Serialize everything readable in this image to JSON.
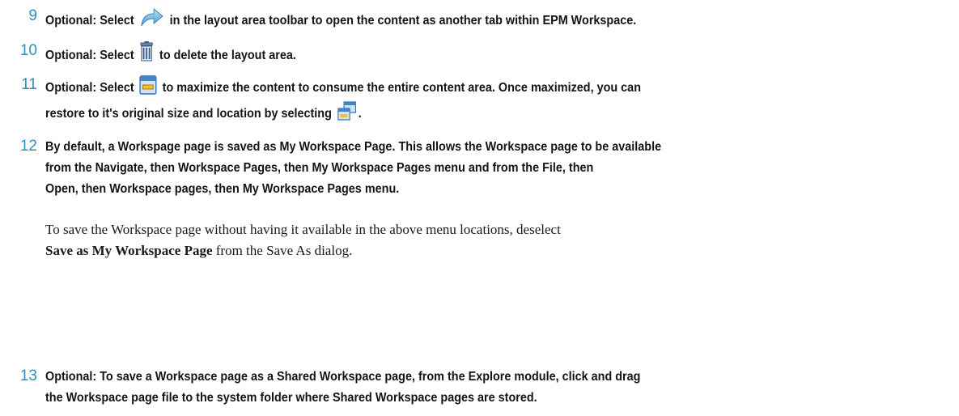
{
  "steps": [
    {
      "number": "9",
      "optional": "Optional:",
      "before_icon": "Select",
      "icon": "open-in-tab-arrow-icon",
      "after_icon": "in the layout area toolbar to open the content as another tab within EPM Workspace."
    },
    {
      "number": "10",
      "optional": "Optional:",
      "before_icon": "Select",
      "icon": "trash-can-icon",
      "after_icon": "to delete the layout area."
    },
    {
      "number": "11",
      "optional": "Optional:",
      "before_icon": "Select",
      "icon": "maximize-window-icon",
      "after_icon": "to maximize the content to consume the entire content area. Once maximized, you can",
      "line2_before_icon": "restore to it's original size and location by selecting",
      "line2_icon": "restore-windows-icon",
      "line2_after_icon": "."
    },
    {
      "number": "12",
      "line1": "By default, a Workspage page is saved as My Workspace Page. This allows the Workspace page to be available",
      "line2_a": "from the",
      "nav": "Navigate",
      "then1": ", then",
      "wp": "Workspace Pages",
      "then2": ", then",
      "mwp": "My Workspace Pages",
      "line2_b": "menu and from the",
      "file": "File",
      "then3": ", then",
      "open": "Open",
      "then4": ", then",
      "wpl": "Workspace pages",
      "then5": ", then",
      "mwp2": "My Workspace Pages",
      "line3_end": "menu.",
      "para_line1": "To save the Workspace page without having it available in the above menu locations, deselect",
      "para_bold": "Save as My Workspace Page",
      "para_rest": "from the Save As dialog."
    },
    {
      "number": "13",
      "optional": "Optional:",
      "line1": "To save a Workspace page as a Shared Workspace page, from the Explore module, click and drag",
      "line2": "the Workspace page file to the system folder where Shared Workspace pages are stored."
    }
  ],
  "colors": {
    "step_number": "#2e8fc0",
    "text": "#141414"
  }
}
